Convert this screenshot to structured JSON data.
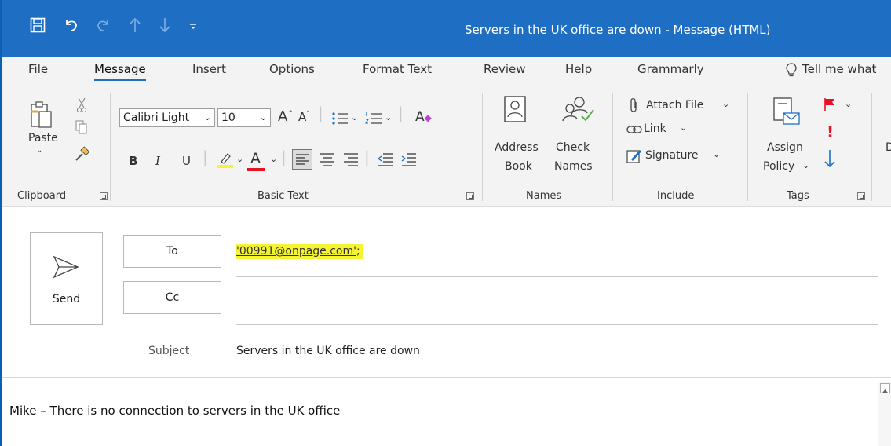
{
  "window": {
    "title": "Servers in the UK office are down  -  Message (HTML)"
  },
  "quick_access": {
    "save_icon": "save-icon",
    "undo_icon": "undo-icon",
    "redo_icon": "redo-icon",
    "up_icon": "up-arrow-icon",
    "down_icon": "down-arrow-icon",
    "customize_icon": "customize-qat-icon"
  },
  "tabs": [
    "File",
    "Message",
    "Insert",
    "Options",
    "Format Text",
    "Review",
    "Help",
    "Grammarly"
  ],
  "active_tab": "Message",
  "tell_me": "Tell me what",
  "ribbon": {
    "clipboard": {
      "label": "Clipboard",
      "paste": "Paste"
    },
    "basic_text": {
      "label": "Basic Text",
      "font_name": "Calibri Light",
      "font_size": "10",
      "bold": "B",
      "italic": "I",
      "underline": "U",
      "font_color_letter": "A",
      "grow_font": "A",
      "shrink_font": "A",
      "clear_format": "A"
    },
    "names": {
      "label": "Names",
      "address_book_1": "Address",
      "address_book_2": "Book",
      "check_names_1": "Check",
      "check_names_2": "Names"
    },
    "include": {
      "label": "Include",
      "attach_file": "Attach File",
      "link": "Link",
      "signature": "Signature"
    },
    "tags": {
      "label": "Tags",
      "assign_policy_1": "Assign",
      "assign_policy_2": "Policy"
    },
    "cut_off_letter": "D"
  },
  "compose": {
    "send": "Send",
    "to_button": "To",
    "cc_button": "Cc",
    "to_value": "'00991@onpage.com'",
    "to_separator": ";",
    "subject_label": "Subject",
    "subject_value": "Servers in the UK office are down",
    "body": "Mike – There is no connection to servers in the UK office"
  },
  "colors": {
    "title_bar": "#1e6fc3",
    "highlight": "#f4f432",
    "font_color_bar": "#e81123",
    "tag_red": "#e81123",
    "tag_blue": "#1e6fc3"
  }
}
